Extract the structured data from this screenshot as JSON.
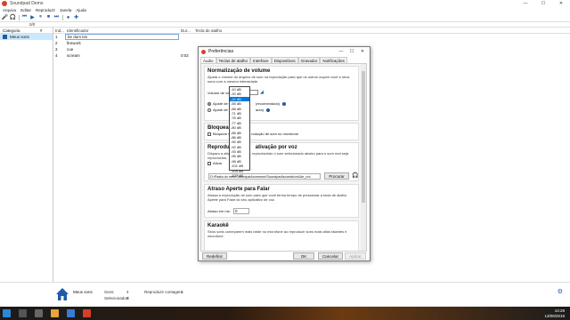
{
  "app": {
    "title": "Soundpad Demo"
  },
  "menu": [
    "Arquivo",
    "Editar",
    "Reproduzir",
    "Janela",
    "Ajuda"
  ],
  "search": {
    "value": "0/0"
  },
  "categories": {
    "header": "Categoria",
    "header_count": "#",
    "items": [
      {
        "label": "Meus sons"
      }
    ]
  },
  "songs": {
    "headers": {
      "index": "Ind...",
      "id": "Identificador",
      "dur": "Dur...",
      "key": "Tecla de atalho"
    },
    "rows": [
      {
        "index": "1",
        "id": "be dum tss",
        "dur": ""
      },
      {
        "index": "2",
        "id": "firework",
        "dur": ""
      },
      {
        "index": "3",
        "id": "cue",
        "dur": ""
      },
      {
        "index": "4",
        "id": "scream",
        "dur": "0:02"
      }
    ]
  },
  "bottom": {
    "category": "Meus sons",
    "sounds_label": "Sons:",
    "sounds_value": "4",
    "selected_label": "Selecionados:",
    "selected_value": "0",
    "playcount_label": "Reproduzir contagem:",
    "playcount_value": "1"
  },
  "taskbar": {
    "time": "14:28",
    "date": "13/06/2018"
  },
  "dialog": {
    "title": "Preferências",
    "tabs": [
      "Áudio",
      "Teclas de atalho",
      "Interface",
      "Dispositivos",
      "Gravador",
      "Notificações"
    ],
    "group1": {
      "title": "Normalização de volume",
      "desc": "Ajusta o volume do arquivo de som na reprodução para que os outros ouçam você e seus sons com a mesma intensidade.",
      "volume_label": "Volume de voz:",
      "volume_value": "-22 dB",
      "radio1": "Ajuste de vo",
      "radio1_suffix": "(recomendado)",
      "radio2": "Ajuste de vo",
      "radio2_suffix": "auto)"
    },
    "dropdown": {
      "selected": "-22 dB",
      "options": [
        "-10 dB",
        "-20 dB",
        "-22 dB",
        "-55 dB",
        "-68 dB",
        "-71 dB",
        "-76 dB",
        "-77 dB",
        "-80 dB",
        "-85 dB",
        "-86 dB",
        "-90 dB",
        "-92 dB",
        "-93 dB",
        "-95 dB",
        "-98 dB",
        "-101 dB",
        "-104 dB",
        "-107 dB"
      ]
    },
    "group2": {
      "title": "Bloquear vo",
      "check": "Bloquear v",
      "check_suffix": "rodução de som no microfone"
    },
    "group3": {
      "title": "Reproduz",
      "title_suffix": "ativação por voz",
      "desc": "Dispara a ativa                              u aplicativo, reproduzindo o som selecionado abaixo para                                 e som real seja reproduzido.",
      "check": "Ativar",
      "path": "D:\\Pasta do meu\\Soundpad\\common\\Soundpad\\sounds\\vrAAe_noi",
      "browse": "Procurar"
    },
    "group4": {
      "title": "Atraso Aperte para Falar",
      "desc": "Atrasa a reprodução de som para que você tenha tempo de pressionar a tecla de atalho Aperte para Falar do seu aplicativo de voz.",
      "delay_label": "Atraso em ms:",
      "delay_value": "0"
    },
    "group5": {
      "title": "Karaokê",
      "desc": "Seus sons começarem mais tarde no microfone ao reproduzir sons mais altos falantes e microfone."
    },
    "buttons": {
      "reset": "Redefinir",
      "ok": "OK",
      "cancel": "Cancelar",
      "apply": "Aplicar"
    }
  }
}
